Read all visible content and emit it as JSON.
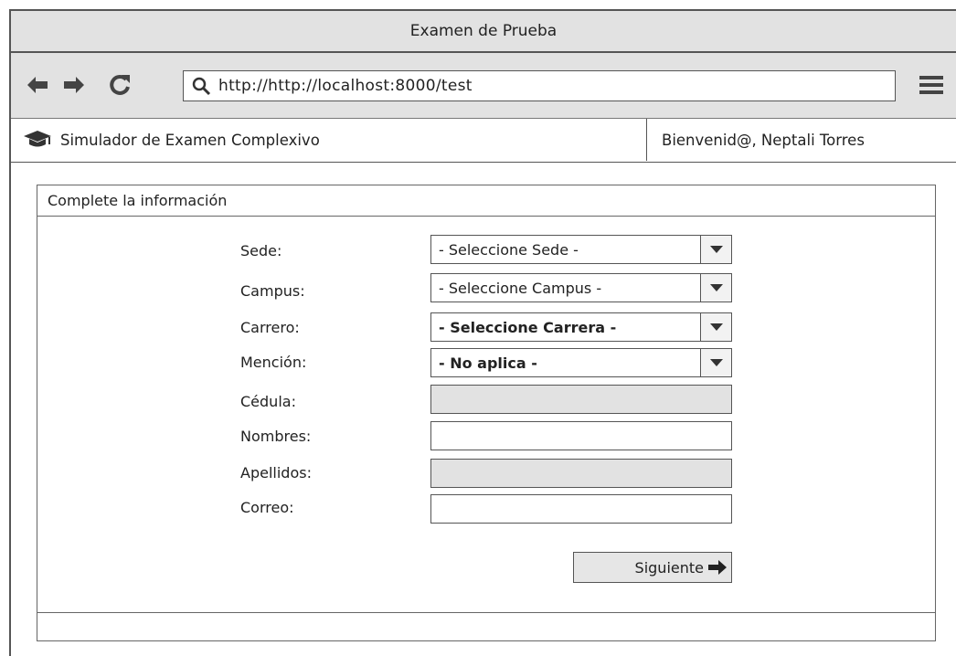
{
  "window": {
    "title": "Examen de Prueba"
  },
  "browser": {
    "url": "http://http://localhost:8000/test",
    "icons": [
      "back-arrow-icon",
      "forward-arrow-icon",
      "reload-icon",
      "search-icon",
      "hamburger-menu-icon"
    ]
  },
  "app": {
    "title": "Simulador de Examen Complexivo",
    "logo_icon": "graduation-cap-icon",
    "welcome": "Bienvenid@, Neptali Torres"
  },
  "form": {
    "header": "Complete la información",
    "fields": [
      {
        "label": "Sede:",
        "type": "select",
        "value": "- Seleccione Sede -",
        "bold": false
      },
      {
        "label": "Campus:",
        "type": "select",
        "value": "- Seleccione Campus -",
        "bold": false
      },
      {
        "label": "Carrero:",
        "type": "select",
        "value": "- Seleccione Carrera -",
        "bold": true
      },
      {
        "label": "Mención:",
        "type": "select",
        "value": "- No aplica -",
        "bold": true
      },
      {
        "label": "Cédula:",
        "type": "input",
        "value": "",
        "disabled": true
      },
      {
        "label": "Nombres:",
        "type": "input",
        "value": "",
        "disabled": false
      },
      {
        "label": "Apellidos:",
        "type": "input",
        "value": "",
        "disabled": true
      },
      {
        "label": "Correo:",
        "type": "input",
        "value": "",
        "disabled": false
      }
    ],
    "next_label": "Siguiente",
    "next_icon": "arrow-right-icon"
  },
  "colors": {
    "chrome": "#e2e2e2",
    "border": "#555555",
    "disabled_input": "#e2e2e2"
  }
}
